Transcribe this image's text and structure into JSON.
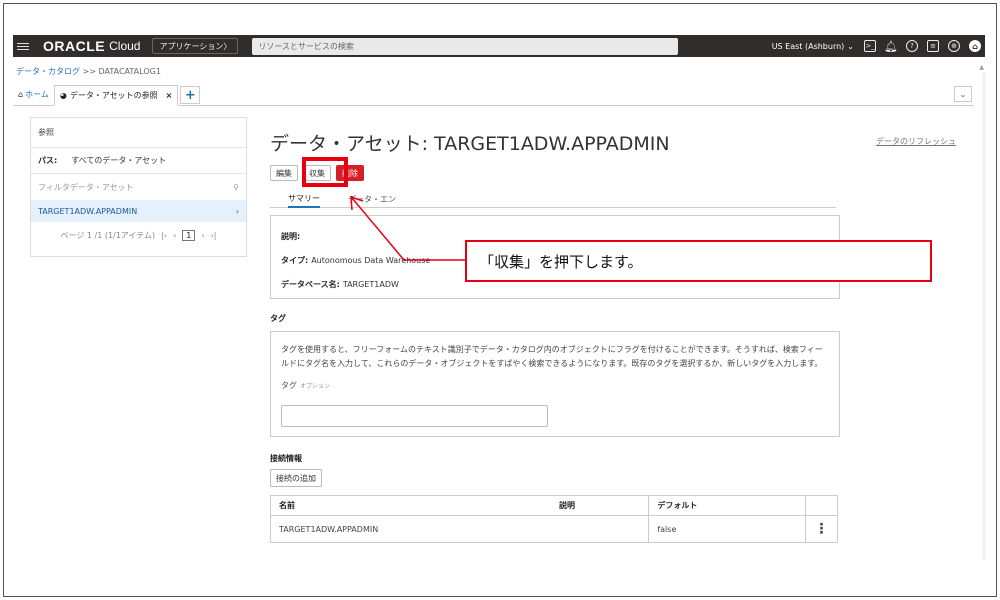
{
  "topbar": {
    "brand": "ORACLE",
    "brand_suffix": "Cloud",
    "apps_label": "アプリケーション〉",
    "search_placeholder": "リソースとサービスの検索",
    "region": "US East (Ashburn)"
  },
  "breadcrumb": {
    "root": "データ・カタログ",
    "sep": " >> ",
    "current": "DATACATALOG1"
  },
  "tabs": [
    {
      "label": "ホーム"
    },
    {
      "label": "データ・アセットの参照",
      "close": "×"
    }
  ],
  "tab_add": "+",
  "left_panel": {
    "title": "参照",
    "path_label": "パス:",
    "path_value": "すべてのデータ・アセット",
    "filter_placeholder": "フィルタデータ・アセット",
    "items": [
      {
        "label": "TARGET1ADW.APPADMIN"
      }
    ],
    "pager_text": "ページ 1 /1 (1/1アイテム)",
    "pager_page": "1"
  },
  "main": {
    "title": "データ・アセット: TARGET1ADW.APPADMIN",
    "refresh_link": "データのリフレッシュ",
    "buttons": {
      "edit": "編集",
      "harvest": "収集",
      "delete": "削除"
    },
    "subtabs": [
      {
        "label": "サマリー"
      },
      {
        "label": "データ・エン"
      }
    ],
    "summary": {
      "description_label": "説明:",
      "type_label": "タイプ:",
      "type_value": "Autonomous Data Warehouse",
      "db_label": "データベース名:",
      "db_value": "TARGET1ADW"
    },
    "tags": {
      "heading": "タグ",
      "help_text": "タグを使用すると、フリーフォームのテキスト識別子でデータ・カタログ内のオブジェクトにフラグを付けることができます。そうすれば、検索フィールドにタグ名を入力して、これらのデータ・オブジェクトをすばやく検索できるようになります。既存のタグを選択するか、新しいタグを入力します。",
      "field_label": "タグ",
      "optional": "オプション"
    },
    "connections": {
      "heading": "接続情報",
      "add_button": "接続の追加",
      "columns": [
        "名前",
        "説明",
        "デフォルト"
      ],
      "rows": [
        {
          "name": "TARGET1ADW.APPADMIN",
          "description": "",
          "default": "false"
        }
      ]
    }
  },
  "callout": {
    "text": "「収集」を押下します。",
    "color": "#e60012"
  }
}
